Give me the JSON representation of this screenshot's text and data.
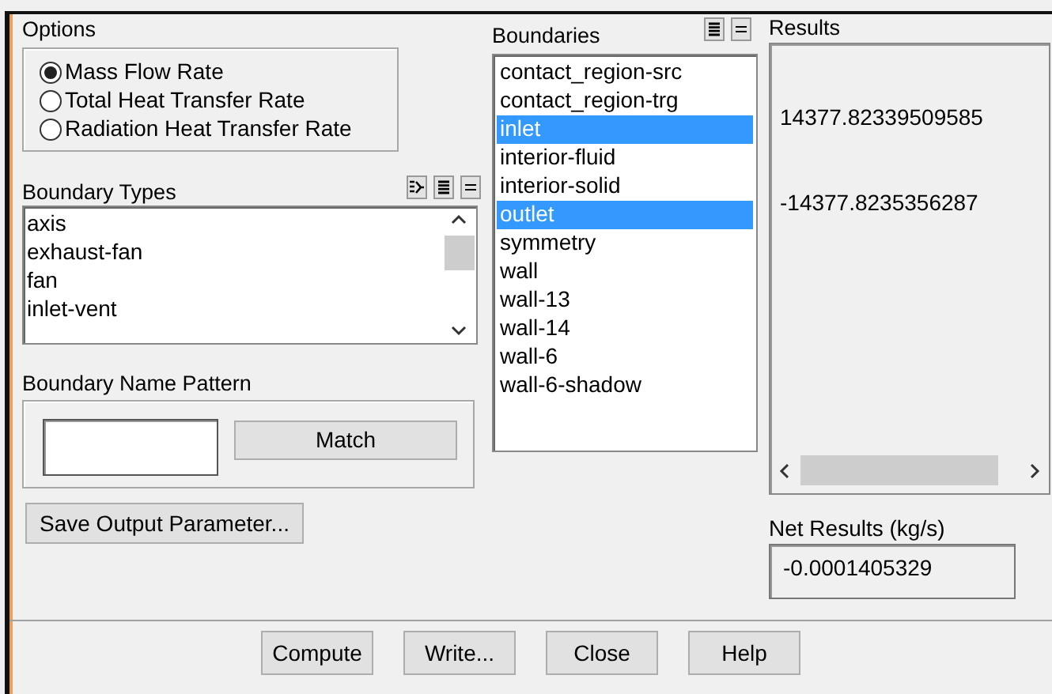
{
  "options": {
    "label": "Options",
    "items": [
      {
        "label": "Mass Flow Rate",
        "selected": true
      },
      {
        "label": "Total Heat Transfer Rate",
        "selected": false
      },
      {
        "label": "Radiation Heat Transfer Rate",
        "selected": false
      }
    ]
  },
  "boundary_types": {
    "label": "Boundary Types",
    "items": [
      {
        "label": "axis",
        "selected": false
      },
      {
        "label": "exhaust-fan",
        "selected": false
      },
      {
        "label": "fan",
        "selected": false
      },
      {
        "label": "inlet-vent",
        "selected": false
      }
    ]
  },
  "name_pattern": {
    "label": "Boundary Name Pattern",
    "button": "Match"
  },
  "save_button": "Save Output Parameter...",
  "boundaries": {
    "label": "Boundaries",
    "items": [
      {
        "label": "contact_region-src",
        "selected": false
      },
      {
        "label": "contact_region-trg",
        "selected": false
      },
      {
        "label": "inlet",
        "selected": true
      },
      {
        "label": "interior-fluid",
        "selected": false
      },
      {
        "label": "interior-solid",
        "selected": false
      },
      {
        "label": "outlet",
        "selected": true
      },
      {
        "label": "symmetry",
        "selected": false
      },
      {
        "label": "wall",
        "selected": false
      },
      {
        "label": "wall-13",
        "selected": false
      },
      {
        "label": "wall-14",
        "selected": false
      },
      {
        "label": "wall-6",
        "selected": false
      },
      {
        "label": "wall-6-shadow",
        "selected": false
      }
    ]
  },
  "results": {
    "label": "Results",
    "rows": [
      "",
      "",
      "14377.82339509585",
      "",
      "",
      "-14377.8235356287"
    ]
  },
  "net_results": {
    "label": "Net Results (kg/s)",
    "value": "-0.0001405329"
  },
  "buttons": [
    "Compute",
    "Write...",
    "Close",
    "Help"
  ]
}
